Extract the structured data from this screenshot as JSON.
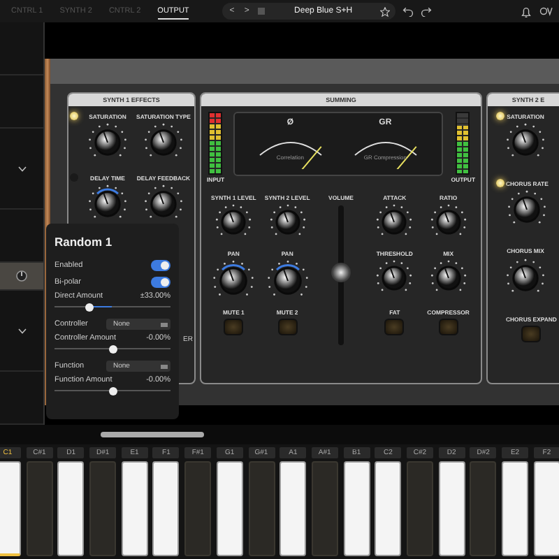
{
  "top_bar": {
    "tabs": [
      {
        "label": "CNTRL 1",
        "selected": false
      },
      {
        "label": "SYNTH 2",
        "selected": false
      },
      {
        "label": "CNTRL 2",
        "selected": false
      },
      {
        "label": "OUTPUT",
        "selected": true
      }
    ],
    "preset": {
      "prev": "<",
      "next": ">",
      "name": "Deep Blue S+H",
      "favorite": false
    }
  },
  "sidebar": {
    "rows": [
      {
        "kind": "empty"
      },
      {
        "kind": "empty"
      },
      {
        "kind": "chevron"
      },
      {
        "kind": "empty"
      },
      {
        "kind": "knob"
      },
      {
        "kind": "chevron"
      },
      {
        "kind": "empty"
      }
    ]
  },
  "synth1_effects": {
    "title": "SYNTH 1 EFFECTS",
    "footer": "ER",
    "controls": [
      {
        "label": "SATURATION",
        "modulated": false,
        "led_on": true
      },
      {
        "label": "SATURATION TYPE",
        "modulated": false
      },
      {
        "label": "DELAY TIME",
        "modulated": true,
        "led_on": false
      },
      {
        "label": "DELAY FEEDBACK",
        "modulated": false
      }
    ]
  },
  "summing": {
    "title": "SUMMING",
    "input_meter": {
      "label": "INPUT",
      "level": 1
    },
    "output_meter": {
      "label": "OUTPUT",
      "level": 0.8
    },
    "vu_meters": [
      {
        "symbol": "Ø",
        "caption": "Correlation"
      },
      {
        "symbol": "GR",
        "caption": "GR Compression"
      }
    ],
    "volume": {
      "label": "VOLUME",
      "level": 0.52
    },
    "controls": [
      {
        "kind": "knob",
        "label": "SYNTH 1 LEVEL",
        "modulated": false
      },
      {
        "kind": "knob",
        "label": "SYNTH 2 LEVEL",
        "modulated": false
      },
      {
        "kind": "knob",
        "label": "ATTACK",
        "modulated": false
      },
      {
        "kind": "knob",
        "label": "RATIO",
        "modulated": false
      },
      {
        "kind": "knob",
        "label": "PAN",
        "modulated": true
      },
      {
        "kind": "knob",
        "label": "PAN",
        "modulated": true
      },
      {
        "kind": "knob",
        "label": "THRESHOLD",
        "modulated": false
      },
      {
        "kind": "knob",
        "label": "MIX",
        "modulated": false
      },
      {
        "kind": "button",
        "label": "MUTE 1"
      },
      {
        "kind": "button",
        "label": "MUTE 2"
      },
      {
        "kind": "button",
        "label": "FAT"
      },
      {
        "kind": "button",
        "label": "COMPRESSOR"
      }
    ]
  },
  "synth2_effects": {
    "title": "SYNTH 2 E",
    "controls": [
      {
        "kind": "knob",
        "label": "SATURATION",
        "modulated": false,
        "led_on": true
      },
      {
        "kind": "knob",
        "label": "CHORUS RATE",
        "modulated": false,
        "led_on": true
      },
      {
        "kind": "knob",
        "label": "CHORUS MIX",
        "modulated": false
      },
      {
        "kind": "button",
        "label": "CHORUS EXPAND"
      }
    ]
  },
  "popup": {
    "title": "Random 1",
    "toggles": [
      {
        "label": "Enabled",
        "on": true
      },
      {
        "label": "Bi-polar",
        "on": true
      }
    ],
    "rows": [
      {
        "kind": "slider",
        "label": "Direct Amount",
        "reading": "±33.00%",
        "level": 0.3
      },
      {
        "kind": "select",
        "label": "Controller",
        "value": "None"
      },
      {
        "kind": "slider",
        "label": "Controller Amount",
        "reading": "-0.00%",
        "level": 0.5
      },
      {
        "kind": "select",
        "label": "Function",
        "value": "None"
      },
      {
        "kind": "slider",
        "label": "Function Amount",
        "reading": "-0.00%",
        "level": 0.5
      }
    ]
  },
  "keyboard": {
    "keys": [
      {
        "note": "C1",
        "kind": "white",
        "selected": true
      },
      {
        "note": "C#1",
        "kind": "black",
        "selected": false
      },
      {
        "note": "D1",
        "kind": "white",
        "selected": false
      },
      {
        "note": "D#1",
        "kind": "black",
        "selected": false
      },
      {
        "note": "E1",
        "kind": "white",
        "selected": false
      },
      {
        "note": "F1",
        "kind": "white",
        "selected": false
      },
      {
        "note": "F#1",
        "kind": "black",
        "selected": false
      },
      {
        "note": "G1",
        "kind": "white",
        "selected": false
      },
      {
        "note": "G#1",
        "kind": "black",
        "selected": false
      },
      {
        "note": "A1",
        "kind": "white",
        "selected": false
      },
      {
        "note": "A#1",
        "kind": "black",
        "selected": false
      },
      {
        "note": "B1",
        "kind": "white",
        "selected": false
      },
      {
        "note": "C2",
        "kind": "white",
        "selected": false
      },
      {
        "note": "C#2",
        "kind": "black",
        "selected": false
      },
      {
        "note": "D2",
        "kind": "white",
        "selected": false
      },
      {
        "note": "D#2",
        "kind": "black",
        "selected": false
      },
      {
        "note": "E2",
        "kind": "white",
        "selected": false
      },
      {
        "note": "F2",
        "kind": "white",
        "selected": false
      }
    ]
  }
}
